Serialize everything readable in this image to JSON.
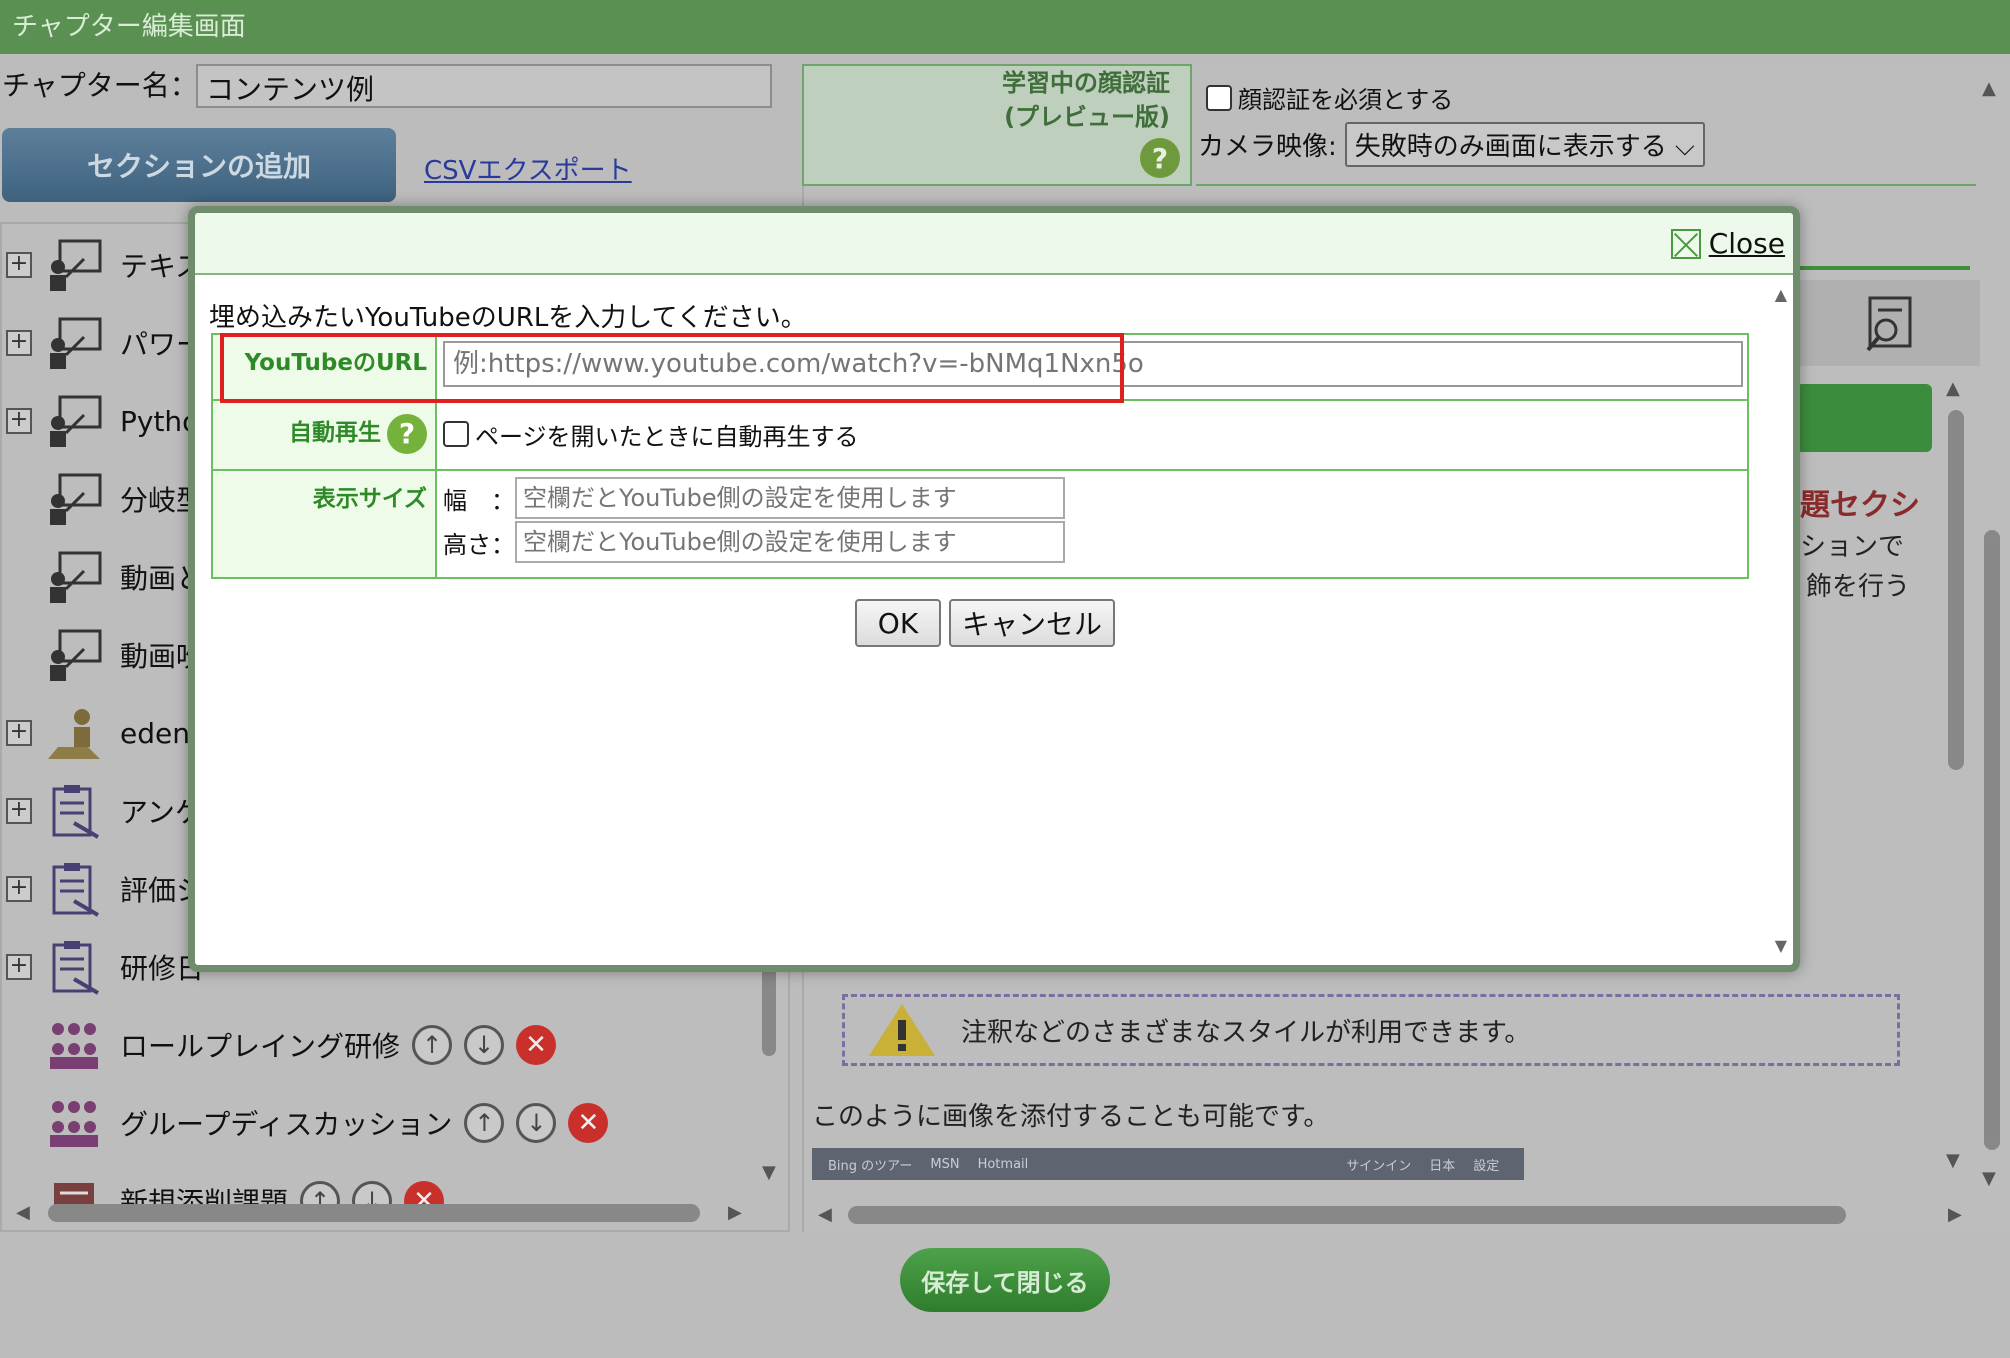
{
  "window": {
    "title": "チャプター編集画面"
  },
  "chapter": {
    "name_label": "チャプター名：",
    "name_value": "コンテンツ例"
  },
  "toolbar": {
    "add_section": "セクションの追加",
    "csv_export": "CSVエクスポート"
  },
  "face_auth": {
    "title_line1": "学習中の顔認証",
    "title_line2": "(プレビュー版)",
    "help": "?",
    "require_label": "顔認証を必須とする",
    "camera_label": "カメラ映像:",
    "camera_value": "失敗時のみ画面に表示する"
  },
  "tree": {
    "items": [
      {
        "label": "テキス"
      },
      {
        "label": "パワー"
      },
      {
        "label": "Pythor"
      },
      {
        "label": "分岐型"
      },
      {
        "label": "動画と"
      },
      {
        "label": "動画吹"
      },
      {
        "label": "eden"
      },
      {
        "label": "アンケ"
      },
      {
        "label": "評価シ"
      },
      {
        "label": "研修日"
      },
      {
        "label": "ロールプレイング研修"
      },
      {
        "label": "グループディスカッション"
      },
      {
        "label": "新規添削課題"
      }
    ]
  },
  "preview": {
    "red_heading": "題セクシ",
    "snippet1": "ションで",
    "snippet2": "飾を行う",
    "note_text": "注釈などのさまざまなスタイルが利用できます。",
    "attach_text": "このように画像を添付することも可能です。",
    "bing_items": [
      "Bing のツアー",
      "MSN",
      "Hotmail",
      "サインイン",
      "日本",
      "設定"
    ]
  },
  "save_button": "保存して閉じる",
  "modal": {
    "close_label": "Close",
    "instruction": "埋め込みたいYouTubeのURLを入力してください。",
    "url_label": "YouTubeのURL",
    "url_placeholder": "例:https://www.youtube.com/watch?v=-bNMq1Nxn5o",
    "autoplay_label": "自動再生",
    "autoplay_help": "?",
    "autoplay_option": "ページを開いたときに自動再生する",
    "size_label": "表示サイズ",
    "width_label": "幅　：",
    "height_label": "高さ：",
    "width_placeholder": "空欄だとYouTube側の設定を使用します",
    "height_placeholder": "空欄だとYouTube側の設定を使用します",
    "ok": "OK",
    "cancel": "キャンセル"
  },
  "colors": {
    "title_bar": "#5a9153",
    "label_green": "#2e8a27",
    "highlight_red": "#e01f1f"
  }
}
